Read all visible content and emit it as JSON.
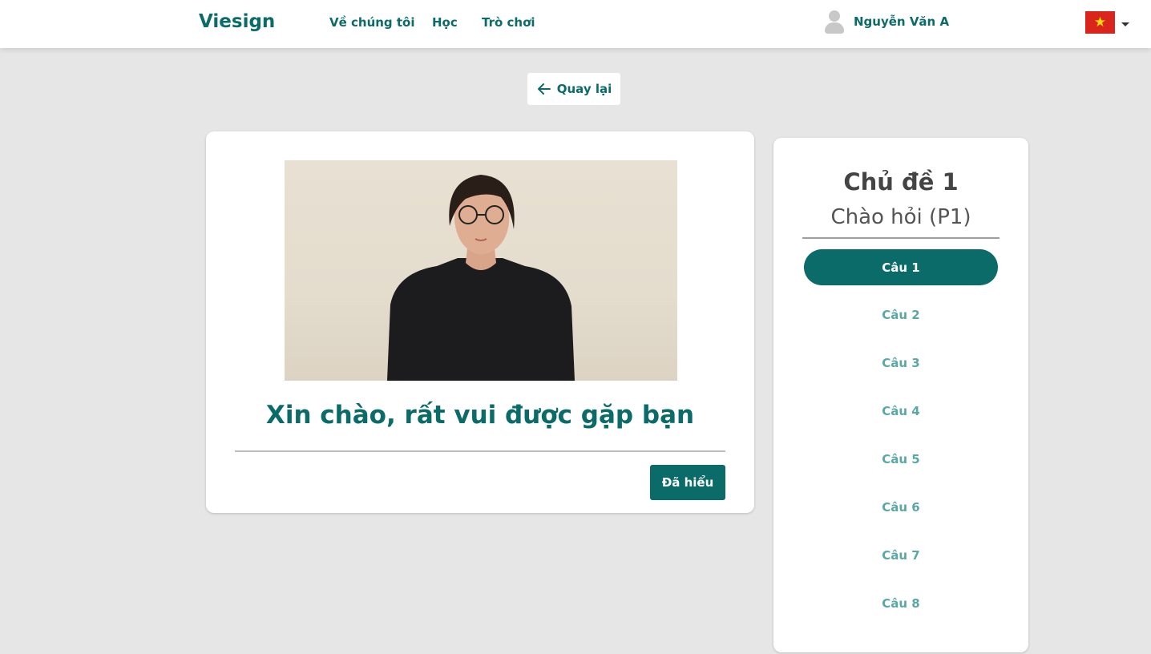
{
  "navbar": {
    "brand": "Viesign",
    "links": [
      "Về chúng tôi",
      "Học",
      "Trò chơi"
    ],
    "user_name": "Nguyễn Văn A",
    "language_flag": "vietnam-flag",
    "flag_star": "★"
  },
  "back_button": {
    "label": "Quay lại"
  },
  "lesson": {
    "phrase": "Xin chào, rất vui được gặp bạn",
    "confirm_label": "Đã hiểu"
  },
  "topic": {
    "title": "Chủ đề 1",
    "subtitle": "Chào hỏi (P1)",
    "questions": [
      "Câu 1",
      "Câu 2",
      "Câu 3",
      "Câu 4",
      "Câu 5",
      "Câu 6",
      "Câu 7",
      "Câu 8"
    ],
    "active_index": 0
  },
  "colors": {
    "accent": "#0b6b68",
    "inactive_item": "#5aa7a4",
    "background": "#e6e6e6",
    "flag_red": "#da251d",
    "flag_star": "#ffdd00"
  }
}
